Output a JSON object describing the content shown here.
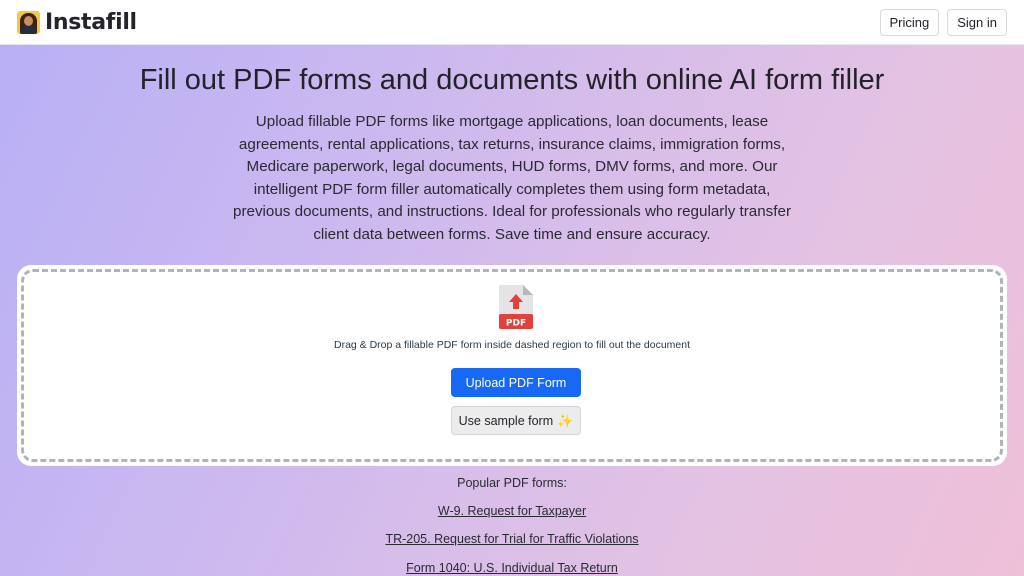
{
  "header": {
    "brand": "Instafill",
    "nav": [
      {
        "label": "Pricing"
      },
      {
        "label": "Sign in"
      }
    ]
  },
  "hero": {
    "title": "Fill out PDF forms and documents with online AI form filler",
    "description": "Upload fillable PDF forms like mortgage applications, loan documents, lease agreements, rental applications, tax returns, insurance claims, immigration forms, Medicare paperwork, legal documents, HUD forms, DMV forms, and more. Our intelligent PDF form filler automatically completes them using form metadata, previous documents, and instructions. Ideal for professionals who regularly transfer client data between forms. Save time and ensure accuracy."
  },
  "upload": {
    "icon_label": "PDF",
    "instruction": "Drag & Drop a fillable PDF form inside dashed region to fill out the document",
    "upload_button": "Upload PDF Form",
    "sample_button": "Use sample form",
    "sample_icon": "✨"
  },
  "popular": {
    "title": "Popular PDF forms:",
    "forms": [
      {
        "label": "W-9. Request for Taxpayer"
      },
      {
        "label": "TR-205. Request for Trial for Traffic Violations"
      },
      {
        "label": "Form 1040: U.S. Individual Tax Return"
      }
    ]
  },
  "colors": {
    "primary_button": "#1769f5",
    "pdf_red": "#e0413b"
  }
}
